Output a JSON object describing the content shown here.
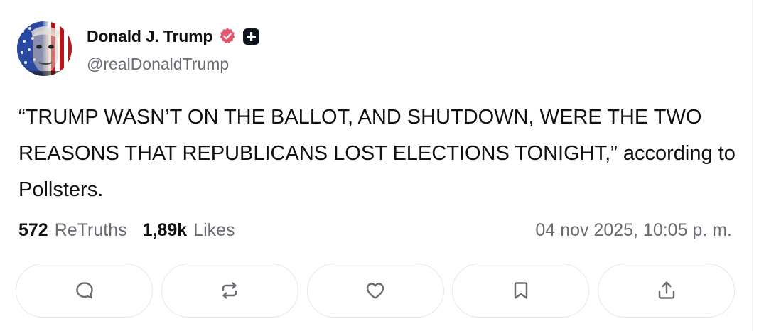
{
  "author": {
    "display_name": "Donald J. Trump",
    "handle": "@realDonaldTrump",
    "verified_color": "#e4566c",
    "badge_icon": "plus-badge-icon"
  },
  "post": {
    "text": "“TRUMP WASN’T ON THE BALLOT, AND SHUTDOWN, WERE THE TWO REASONS THAT REPUBLICANS LOST ELECTIONS TONIGHT,” according to Pollsters."
  },
  "stats": {
    "retruths_count": "572",
    "retruths_label": "ReTruths",
    "likes_count": "1,89k",
    "likes_label": "Likes",
    "timestamp": "04 nov 2025, 10:05 p. m."
  },
  "actions": [
    {
      "icon": "reply-icon"
    },
    {
      "icon": "retruth-icon"
    },
    {
      "icon": "like-icon"
    },
    {
      "icon": "bookmark-icon"
    },
    {
      "icon": "share-icon"
    }
  ],
  "colors": {
    "text": "#111111",
    "muted": "#6b6b73",
    "border": "#e6e6ea"
  }
}
